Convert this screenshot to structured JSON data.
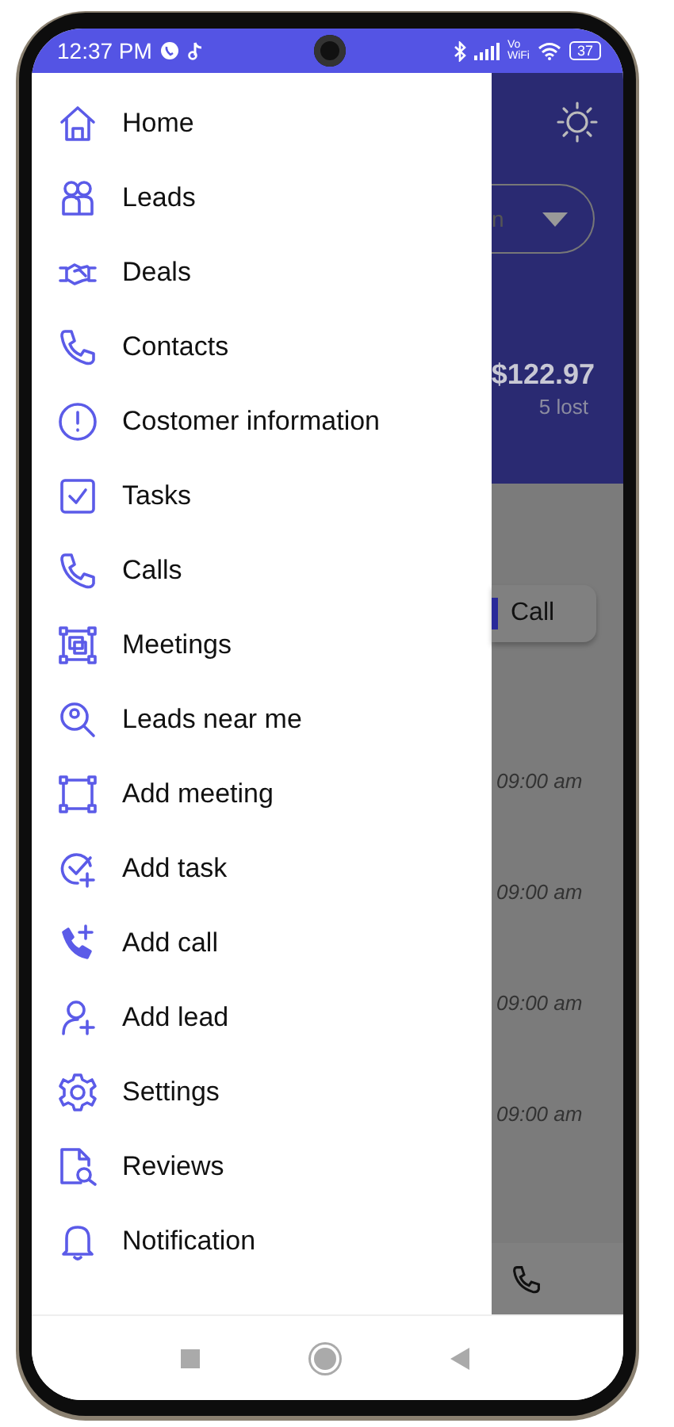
{
  "status_bar": {
    "time": "12:37 PM",
    "vo": "Vo",
    "wifi": "WiFi",
    "battery": "37"
  },
  "drawer": {
    "items": [
      {
        "label": "Home"
      },
      {
        "label": "Leads"
      },
      {
        "label": "Deals"
      },
      {
        "label": "Contacts"
      },
      {
        "label": "Costomer information"
      },
      {
        "label": "Tasks"
      },
      {
        "label": "Calls"
      },
      {
        "label": "Meetings"
      },
      {
        "label": "Leads near me"
      },
      {
        "label": "Add meeting"
      },
      {
        "label": "Add task"
      },
      {
        "label": "Add call"
      },
      {
        "label": "Add lead"
      },
      {
        "label": "Settings"
      },
      {
        "label": "Reviews"
      },
      {
        "label": "Notification"
      }
    ]
  },
  "main": {
    "dropdown_text": "n",
    "amount": "$122.97",
    "lost": "5 lost",
    "call_button": "Call",
    "times": [
      "09:00 am",
      "09:00 am",
      "09:00 am",
      "09:00 am"
    ]
  }
}
